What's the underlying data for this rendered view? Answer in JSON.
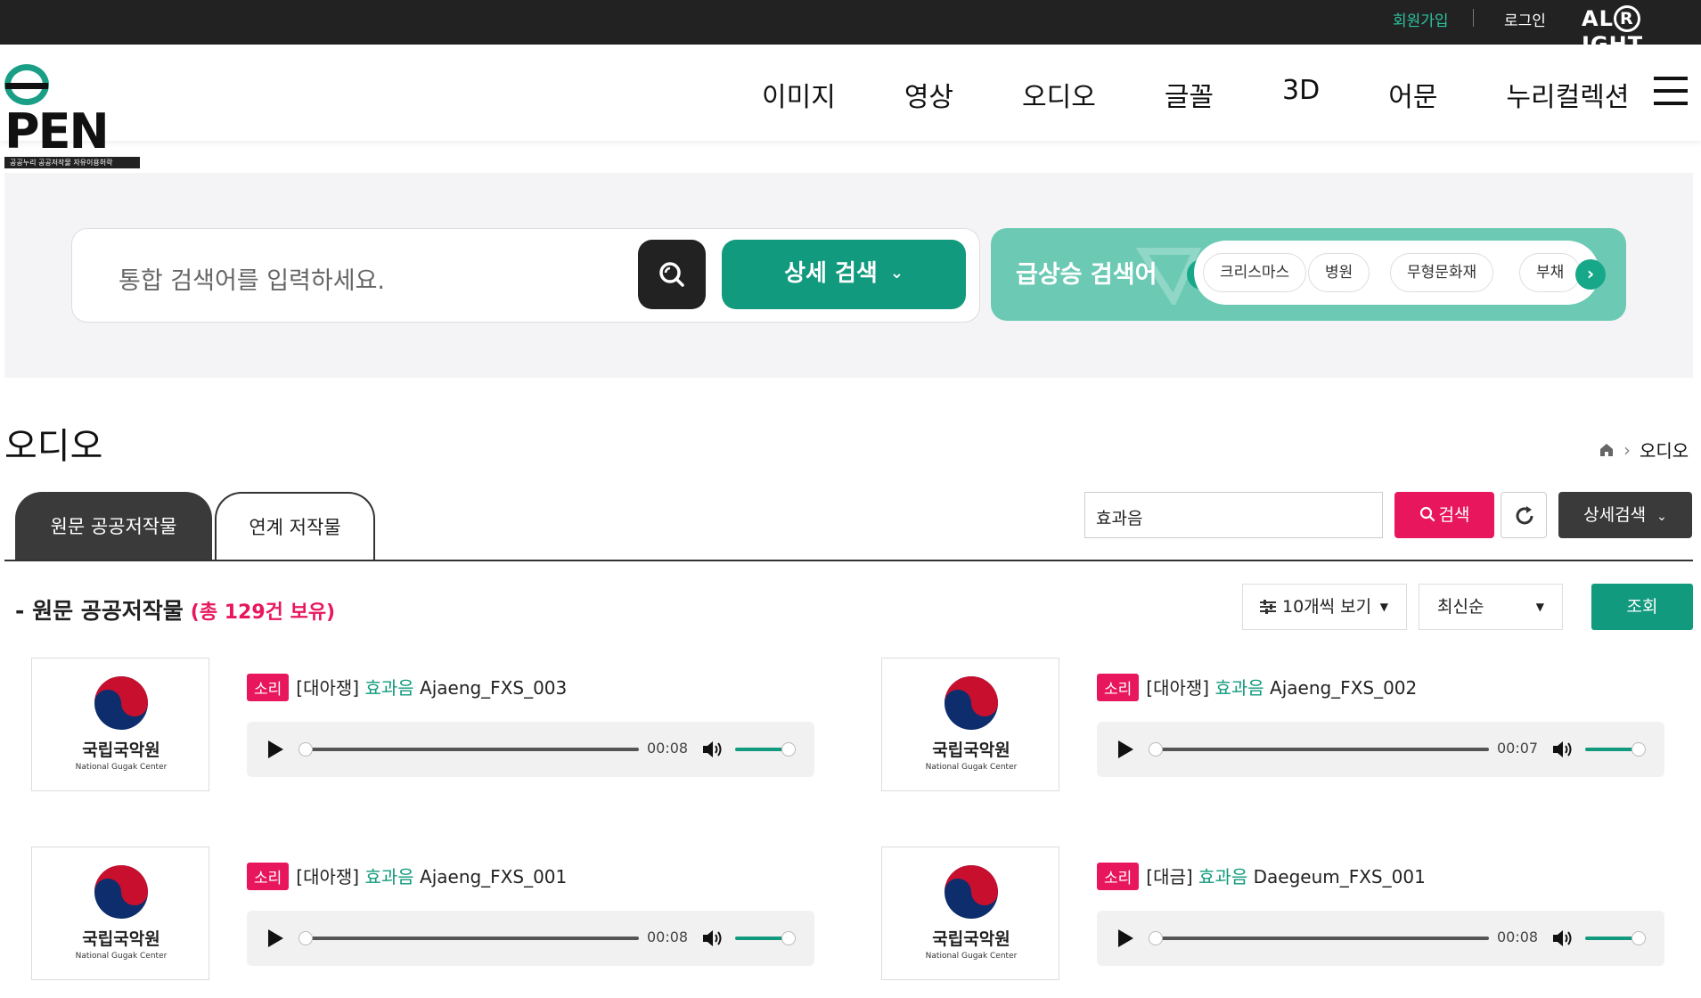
{
  "topbar": {
    "join": "회원가입",
    "login": "로그인",
    "brand_prefix": "AL",
    "brand_r": "R",
    "brand_suffix": "IGHT"
  },
  "logo": {
    "text_o": "",
    "text_rest": "PEN",
    "sub": "공공누리   공공저작물 자유이용허락"
  },
  "nav": [
    "이미지",
    "영상",
    "오디오",
    "글꼴",
    "3D",
    "어문",
    "누리컬렉션"
  ],
  "search": {
    "placeholder": "통합 검색어를 입력하세요.",
    "detail_label": "상세 검색"
  },
  "trending": {
    "label": "급상승 검색어",
    "keywords": [
      "크리스마스",
      "병원",
      "무형문화재",
      "부채"
    ]
  },
  "page": {
    "title": "오디오",
    "breadcrumb_current": "오디오"
  },
  "tabs": {
    "original": "원문 공공저작물",
    "linked": "연계 저작물"
  },
  "filter": {
    "query": "효과음",
    "search_label": "검색",
    "advanced_label": "상세검색"
  },
  "list": {
    "heading": "- 원문 공공저작물",
    "count": "(총 129건 보유)",
    "per_page": "10개씩 보기",
    "sort": "최신순",
    "view_label": "조회"
  },
  "colors": {
    "accent": "#119a7e",
    "pink": "#e8175d",
    "dark": "#222222",
    "trend_bg": "#6ccab4"
  },
  "items": [
    {
      "badge": "소리",
      "category": "[대아쟁]",
      "keyword": "효과음",
      "name": "Ajaeng_FXS_003",
      "duration": "00:08",
      "org": "국립국악원",
      "org_en": "National Gugak Center"
    },
    {
      "badge": "소리",
      "category": "[대아쟁]",
      "keyword": "효과음",
      "name": "Ajaeng_FXS_002",
      "duration": "00:07",
      "org": "국립국악원",
      "org_en": "National Gugak Center"
    },
    {
      "badge": "소리",
      "category": "[대아쟁]",
      "keyword": "효과음",
      "name": "Ajaeng_FXS_001",
      "duration": "00:08",
      "org": "국립국악원",
      "org_en": "National Gugak Center"
    },
    {
      "badge": "소리",
      "category": "[대금]",
      "keyword": "효과음",
      "name": "Daegeum_FXS_001",
      "duration": "00:08",
      "org": "국립국악원",
      "org_en": "National Gugak Center"
    }
  ]
}
